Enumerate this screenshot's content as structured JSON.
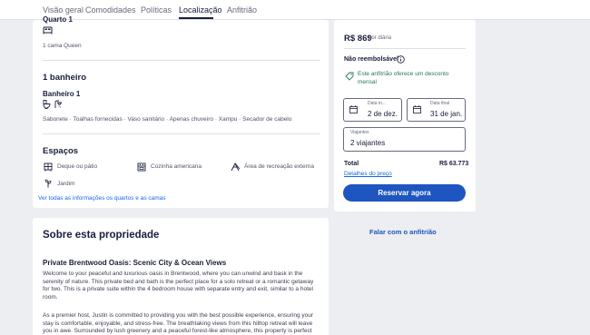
{
  "tabs": [
    "Visão geral",
    "Comodidades",
    "Políticas",
    "Localização",
    "Anfitrião"
  ],
  "rooms": {
    "bedroom_title": "Quarto 1",
    "bed": "1 cama Queen",
    "bathroom_heading": "1 banheiro",
    "bathroom_title": "Banheiro 1",
    "bathroom_amenities": "Sabonete · Toalhas fornecidas · Vaso sanitário · Apenas chuveiro · Xampu · Secador de cabelo",
    "spaces_heading": "Espaços",
    "spaces": [
      "Deque ou pátio",
      "Cozinha americana",
      "Área de recreação externa",
      "Jardim"
    ],
    "see_all_link": "Ver todas as informações os quartos e as camas"
  },
  "about": {
    "heading": "Sobre esta propriedade",
    "title": "Private Brentwood Oasis: Scenic City & Ocean Views",
    "para1": "Welcome to your peaceful and luxurious oasis in Brentwood, where you can unwind and bask in the serenity of nature. This private bed and bath is the perfect place for a solo retreat or a romantic getaway for two. This is a private suite within the 4 bedroom house with separate entry and exit, similar to a hotel room.",
    "para2": "As a premier host, Justin is committed to providing you with the best possible experience, ensuring your stay is comfortable, enjoyable, and stress-free. The breathtaking views from this hilltop retreat will leave you in awe. Surrounded by lush greenery and a peaceful forest-like atmosphere, this property is perfect"
  },
  "booking": {
    "price": "R$ 869",
    "per_night": "por diária",
    "non_refundable": "Não reembolsável",
    "discount_line1": "Este anfitrião oferece um desconto",
    "discount_line2": "mensal",
    "checkin_label": "Data in...",
    "checkin_value": "2 de dez.",
    "checkout_label": "Data final",
    "checkout_value": "31 de jan.",
    "guests_label": "Viajantes",
    "guests_value": "2 viajantes",
    "total_label": "Total",
    "total_value": "R$ 63.773",
    "price_details": "Detalhes do preço",
    "reserve_button": "Reservar agora",
    "contact_host": "Falar com o anfitrião"
  },
  "colors": {
    "accent": "#1e55c0",
    "link": "#1668e3",
    "discount_green": "#227950",
    "background": "#eceef1"
  }
}
